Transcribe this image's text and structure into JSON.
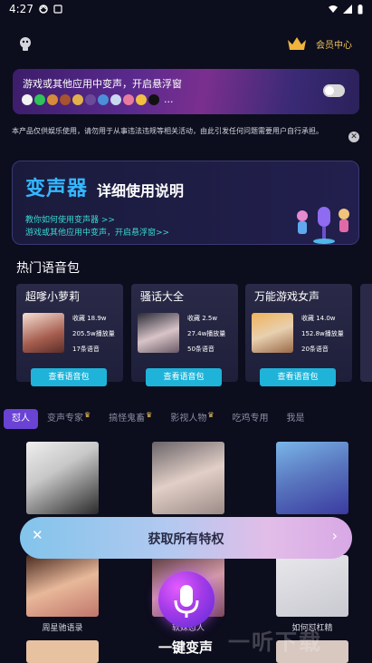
{
  "status_bar": {
    "time": "4:27"
  },
  "header": {
    "vip_center_label": "会员中心"
  },
  "float_banner": {
    "title": "游戏或其他应用中变声，开启悬浮窗",
    "more": "..."
  },
  "disclaimer": {
    "text": "本产品仅供娱乐使用，请勿用于从事违法违规等相关活动，由此引发任何问题需要用户自行承担。"
  },
  "guide": {
    "big_title": "变声器",
    "sub_title": "详细使用说明",
    "link1": "教你如何使用变声器 >>",
    "link2": "游戏或其他应用中变声，开启悬浮窗>>"
  },
  "hot_packs": {
    "section_title": "热门语音包",
    "view_label": "查看语音包",
    "items": [
      {
        "name": "超嗲小萝莉",
        "collect": "收藏 18.9w",
        "plays": "205.5w播放量",
        "count": "17条语音"
      },
      {
        "name": "骚话大全",
        "collect": "收藏 2.5w",
        "plays": "27.4w播放量",
        "count": "50条语音"
      },
      {
        "name": "万能游戏女声",
        "collect": "收藏 14.0w",
        "plays": "152.8w播放量",
        "count": "20条语音"
      }
    ]
  },
  "tabs": [
    {
      "label": "怼人",
      "crown": false
    },
    {
      "label": "变声专家",
      "crown": true
    },
    {
      "label": "搞怪鬼畜",
      "crown": true
    },
    {
      "label": "影视人物",
      "crown": true
    },
    {
      "label": "吃鸡专用",
      "crown": false
    },
    {
      "label": "我是",
      "crown": false
    }
  ],
  "grid": {
    "row2_labels": [
      "周星驰语录",
      "软妹怼人",
      "如何怼杠精"
    ]
  },
  "privilege_bar": {
    "label": "获取所有特权",
    "close": "✕",
    "arrow": "›"
  },
  "mic": {
    "label": "一键变声"
  },
  "watermark": "一听下载",
  "colors": {
    "accent_purple": "#6a42d4",
    "vip_gold": "#f0c35a",
    "guide_blue": "#35b7ff",
    "link_cyan": "#39d8d1",
    "button_teal": "#1fb3d9"
  }
}
